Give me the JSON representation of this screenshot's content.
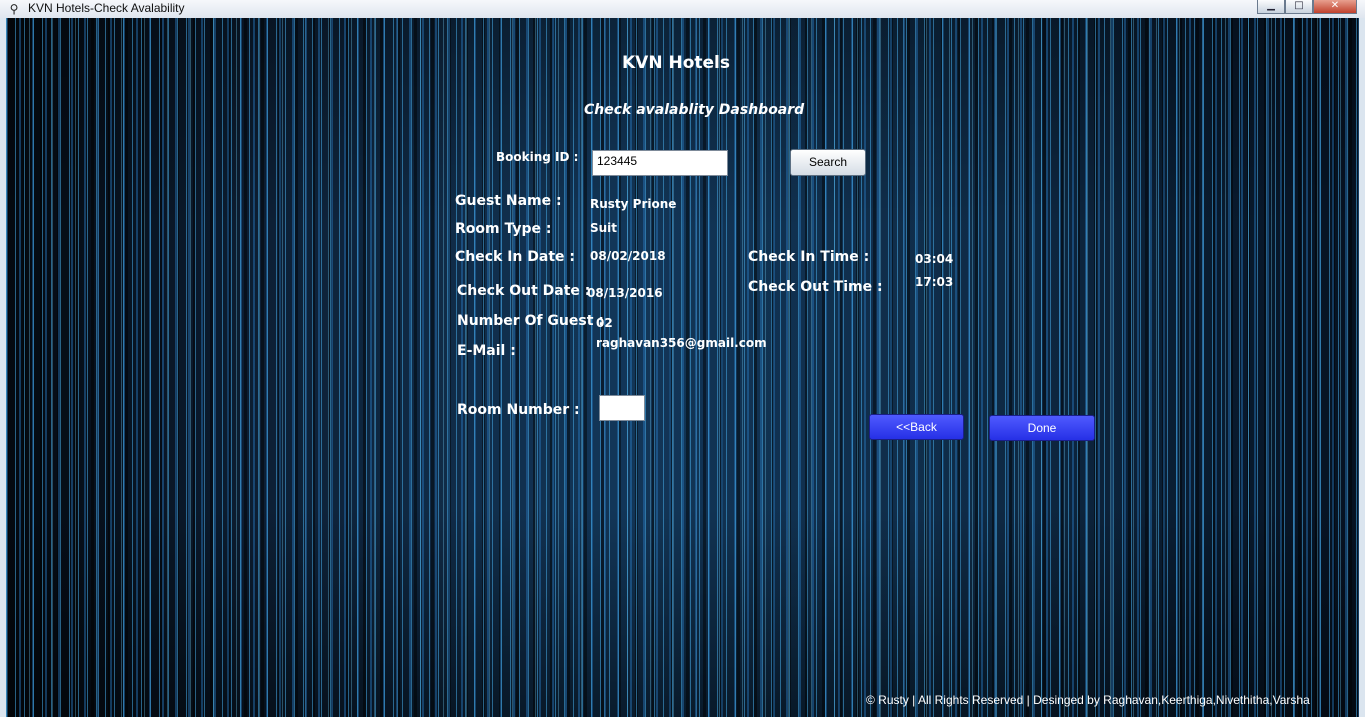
{
  "window": {
    "title": "KVN Hotels-Check Avalability",
    "controls": {
      "minimize": "▁",
      "maximize": "□",
      "close": "✕"
    }
  },
  "header": {
    "title": "KVN Hotels",
    "subtitle": "Check avalablity Dashboard"
  },
  "search": {
    "booking_id_label": "Booking ID :",
    "booking_id_value": "123445",
    "search_button": "Search"
  },
  "details": {
    "guest_name_label": "Guest Name :",
    "guest_name_value": "Rusty Prione",
    "room_type_label": "Room Type :",
    "room_type_value": "Suit",
    "check_in_date_label": "Check In Date :",
    "check_in_date_value": "08/02/2018",
    "check_in_time_label": "Check In Time :",
    "check_in_time_value": "03:04",
    "check_out_date_label": "Check Out Date :",
    "check_out_date_value": "08/13/2016",
    "check_out_time_label": "Check Out Time :",
    "check_out_time_value": "17:03",
    "guests_label": "Number Of Guest :",
    "guests_value": "02",
    "email_label": "E-Mail :",
    "email_value": "raghavan356@gmail.com"
  },
  "room": {
    "room_number_label": "Room Number :",
    "room_number_value": ""
  },
  "actions": {
    "back_button": "<<Back",
    "done_button": "Done"
  },
  "footer": {
    "text": "© Rusty | All Rights Reserved | Desinged by Raghavan,Keerthiga,Nivethitha,Varsha"
  },
  "colors": {
    "background": "#0b1626",
    "stripe": "#46aae6",
    "button_blue": "#3340f0"
  }
}
